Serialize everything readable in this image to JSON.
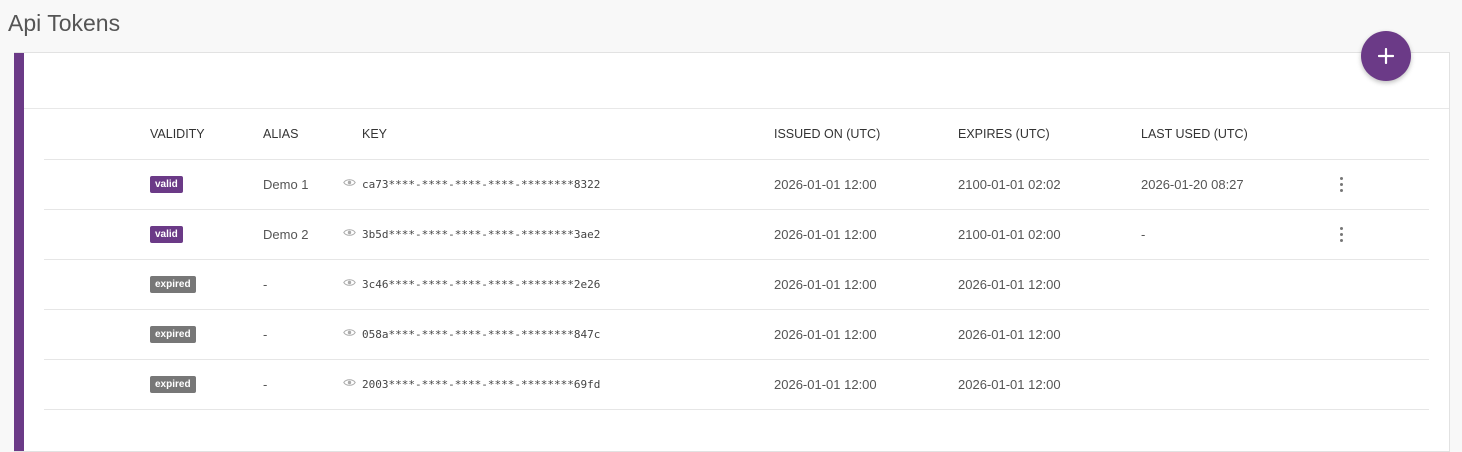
{
  "page": {
    "title": "Api Tokens"
  },
  "colors": {
    "accent": "#6b3a87",
    "expired_badge": "#777777"
  },
  "fab": {
    "icon": "plus-icon",
    "label": "+"
  },
  "table": {
    "headers": {
      "validity": "VALIDITY",
      "alias": "ALIAS",
      "key": "KEY",
      "issued": "ISSUED ON (UTC)",
      "expires": "EXPIRES (UTC)",
      "last_used": "LAST USED (UTC)"
    },
    "rows": [
      {
        "validity": "valid",
        "alias": "Demo 1",
        "key": "ca73****-****-****-****-********8322",
        "issued": "2026-01-01 12:00",
        "expires": "2100-01-01 02:02",
        "last_used": "2026-01-20 08:27",
        "menu": true
      },
      {
        "validity": "valid",
        "alias": "Demo 2",
        "key": "3b5d****-****-****-****-********3ae2",
        "issued": "2026-01-01 12:00",
        "expires": "2100-01-01 02:00",
        "last_used": "-",
        "menu": true
      },
      {
        "validity": "expired",
        "alias": "-",
        "key": "3c46****-****-****-****-********2e26",
        "issued": "2026-01-01 12:00",
        "expires": "2026-01-01 12:00",
        "last_used": "",
        "menu": false
      },
      {
        "validity": "expired",
        "alias": "-",
        "key": "058a****-****-****-****-********847c",
        "issued": "2026-01-01 12:00",
        "expires": "2026-01-01 12:00",
        "last_used": "",
        "menu": false
      },
      {
        "validity": "expired",
        "alias": "-",
        "key": "2003****-****-****-****-********69fd",
        "issued": "2026-01-01 12:00",
        "expires": "2026-01-01 12:00",
        "last_used": "",
        "menu": false
      }
    ]
  }
}
